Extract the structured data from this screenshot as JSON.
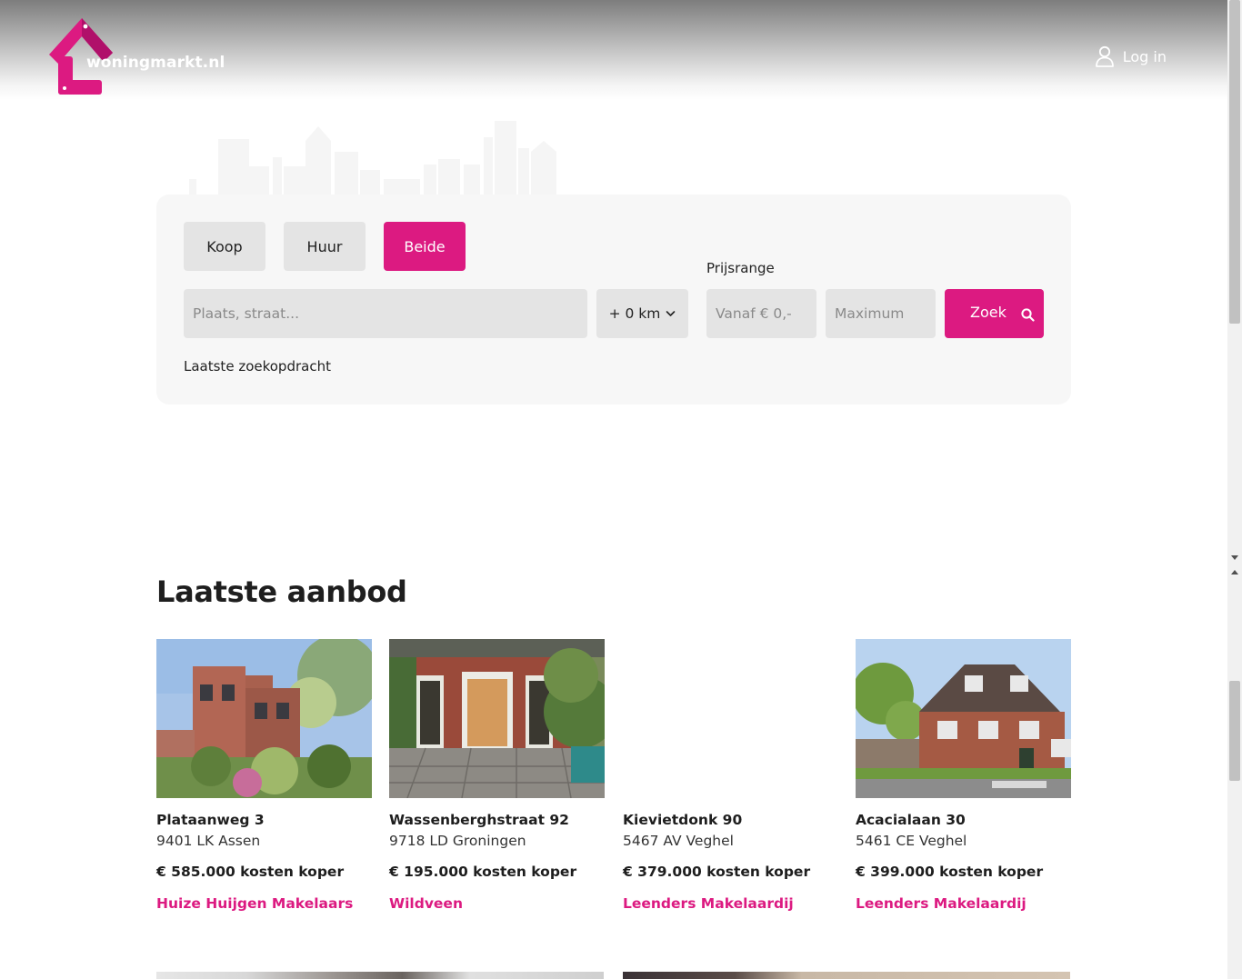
{
  "header": {
    "logo_text": "woningmarkt.nl",
    "login_label": "Log in"
  },
  "search": {
    "tabs": [
      {
        "label": "Koop",
        "active": false
      },
      {
        "label": "Huur",
        "active": false
      },
      {
        "label": "Beide",
        "active": true
      }
    ],
    "location_placeholder": "Plaats, straat...",
    "radius_value": "+ 0 km",
    "price_label": "Prijsrange",
    "min_price_placeholder": "Vanaf € 0,-",
    "max_price_placeholder": "Maximum",
    "search_button_label": "Zoek",
    "last_search_label": "Laatste zoekopdracht"
  },
  "listings_section": {
    "title": "Laatste aanbod",
    "items": [
      {
        "address": "Plataanweg 3",
        "city": "9401 LK Assen",
        "price": "€ 585.000 kosten koper",
        "agent": "Huize Huijgen Makelaars"
      },
      {
        "address": "Wassenberghstraat 92",
        "city": "9718 LD Groningen",
        "price": "€ 195.000 kosten koper",
        "agent": "Wildveen"
      },
      {
        "address": "Kievietdonk 90",
        "city": "5467 AV Veghel",
        "price": "€ 379.000 kosten koper",
        "agent": "Leenders Makelaardij"
      },
      {
        "address": "Acacialaan 30",
        "city": "5461 CE Veghel",
        "price": "€ 399.000 kosten koper",
        "agent": "Leenders Makelaardij"
      }
    ]
  },
  "colors": {
    "brand": "#dc1a81",
    "field_bg": "#e4e4e4",
    "card_bg": "#f7f7f7"
  }
}
